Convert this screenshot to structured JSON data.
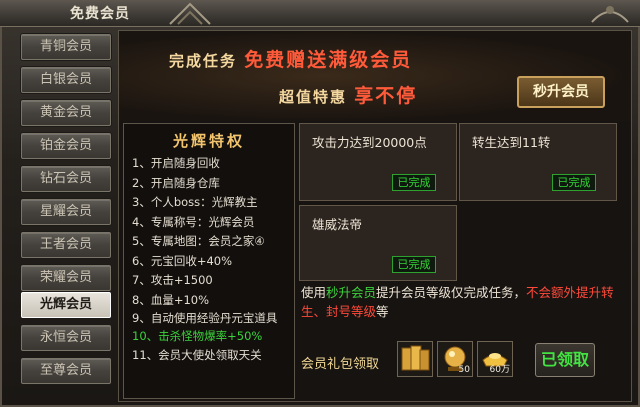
{
  "window": {
    "title": "免费会员"
  },
  "sidebar": {
    "items": [
      {
        "label": "青铜会员"
      },
      {
        "label": "白银会员"
      },
      {
        "label": "黄金会员"
      },
      {
        "label": "铂金会员"
      },
      {
        "label": "钻石会员"
      },
      {
        "label": "星耀会员"
      },
      {
        "label": "王者会员"
      },
      {
        "label": "荣耀会员"
      },
      {
        "label": "光辉会员",
        "active": true
      },
      {
        "label": "永恒会员"
      },
      {
        "label": "至尊会员"
      }
    ]
  },
  "banner": {
    "line1_prefix": "完成任务",
    "line1_highlight": "免费赠送满级会员",
    "line2_prefix": "超值特惠",
    "line2_highlight": "享不停",
    "upgrade_button": "秒升会员"
  },
  "privileges": {
    "title": "光辉特权",
    "items": [
      "1、开启随身回收",
      "2、开启随身仓库",
      "3、个人boss：光辉教主",
      "4、专属称号：光辉会员",
      "5、专属地图：会员之家④",
      "6、元宝回收+40%",
      "7、攻击+1500",
      "8、血量+10%",
      "9、自动使用经验丹元宝道具",
      "10、击杀怪物爆率+50%",
      "11、会员大使处领取天关"
    ]
  },
  "tasks": [
    {
      "label": "攻击力达到20000点",
      "status": "已完成"
    },
    {
      "label": "转生达到11转",
      "status": "已完成"
    },
    {
      "label": "雄威法帝",
      "status": "已完成"
    }
  ],
  "info": {
    "p1": "使用",
    "p2": "秒升会员",
    "p3": "提升会员等级仅完成任务，",
    "p4": "不会额外提",
    "p5": "升转生、封号等级",
    "p6": "等"
  },
  "gift": {
    "label": "会员礼包领取",
    "items": [
      {
        "icon": "gold-bars-icon",
        "count": ""
      },
      {
        "icon": "gold-orb-icon",
        "count": "50"
      },
      {
        "icon": "gold-ingot-icon",
        "count": "60万"
      }
    ],
    "claimed_button": "已领取"
  },
  "colors": {
    "green": "#3cd23c",
    "red": "#ff4a3a",
    "gold": "#f2c56e"
  }
}
